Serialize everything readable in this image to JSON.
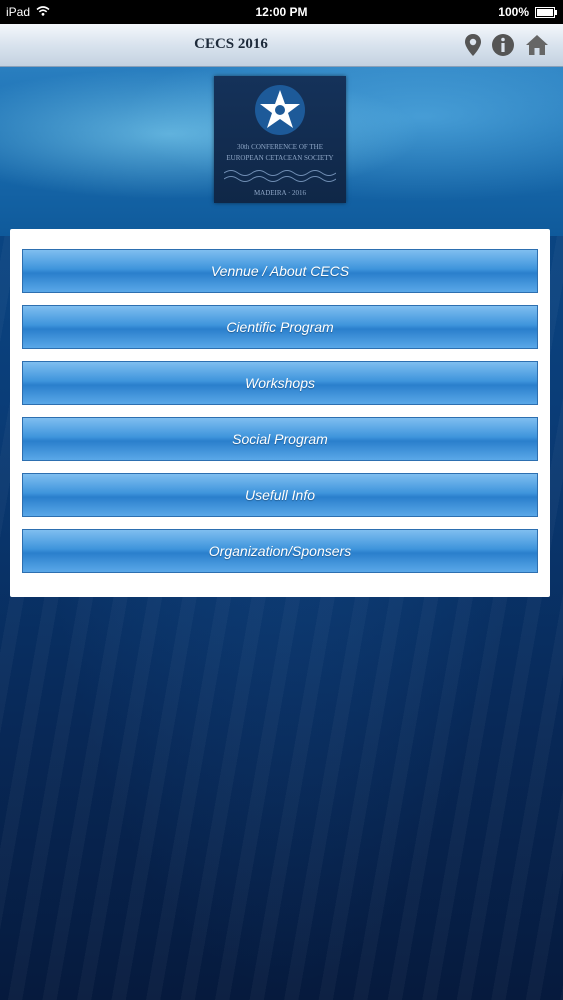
{
  "status_bar": {
    "device": "iPad",
    "time": "12:00 PM",
    "battery": "100%"
  },
  "header": {
    "title": "CECS 2016",
    "icons": [
      "location-pin-icon",
      "info-icon",
      "home-icon"
    ]
  },
  "logo": {
    "line1": "30th CONFERENCE OF THE",
    "line2": "EUROPEAN CETACEAN SOCIETY",
    "line3": "MADEIRA · 2016"
  },
  "menu": {
    "items": [
      "Vennue / About CECS",
      "Cientific Program",
      "Workshops",
      "Social Program",
      "Usefull Info",
      "Organization/Sponsers"
    ]
  },
  "colors": {
    "button_blue": "#3f95dc",
    "background_deep": "#061a3d",
    "panel": "#ffffff"
  }
}
